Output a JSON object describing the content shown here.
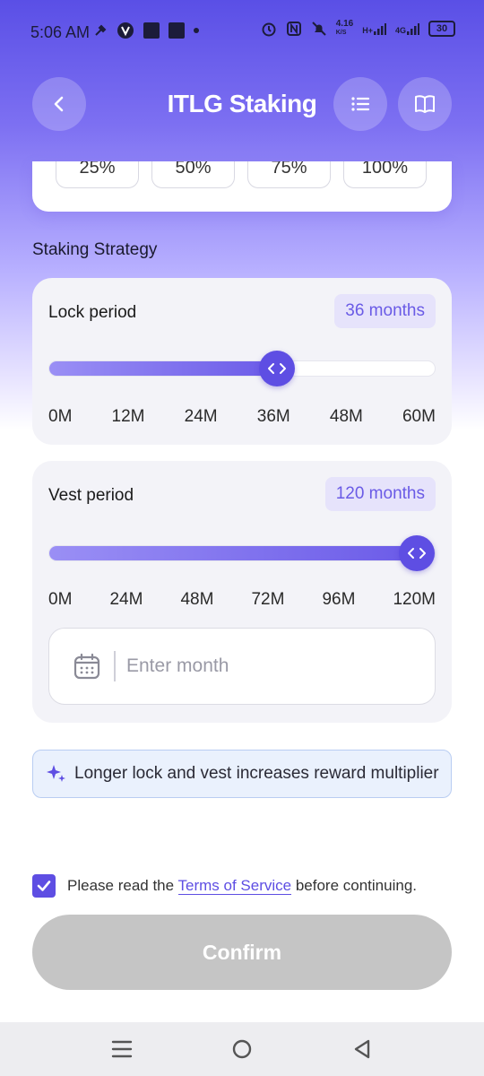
{
  "status": {
    "time": "5:06 AM",
    "net_speed": "4.16",
    "net_unit": "K/S",
    "signal1": "H+",
    "signal2": "4G",
    "battery": "30"
  },
  "header": {
    "title": "ITLG Staking"
  },
  "allocation": {
    "chips": [
      "25%",
      "50%",
      "75%",
      "100%"
    ]
  },
  "strategy": {
    "section_title": "Staking Strategy",
    "lock": {
      "label": "Lock period",
      "value_text": "36 months",
      "value_fraction": 0.6,
      "ticks": [
        "0M",
        "12M",
        "24M",
        "36M",
        "48M",
        "60M"
      ]
    },
    "vest": {
      "label": "Vest period",
      "value_text": "120 months",
      "value_fraction": 1.0,
      "ticks": [
        "0M",
        "24M",
        "48M",
        "72M",
        "96M",
        "120M"
      ],
      "input_placeholder": "Enter month"
    }
  },
  "info": {
    "text": "Longer lock and vest increases reward multiplier"
  },
  "terms": {
    "prefix": "Please read the",
    "link": "Terms of Service",
    "suffix": "before continuing.",
    "checked": true
  },
  "confirm": {
    "label": "Confirm"
  },
  "colors": {
    "accent": "#5e4ee3",
    "disabled_button": "#c5c5c5",
    "info_bg": "#eaf1fd"
  }
}
